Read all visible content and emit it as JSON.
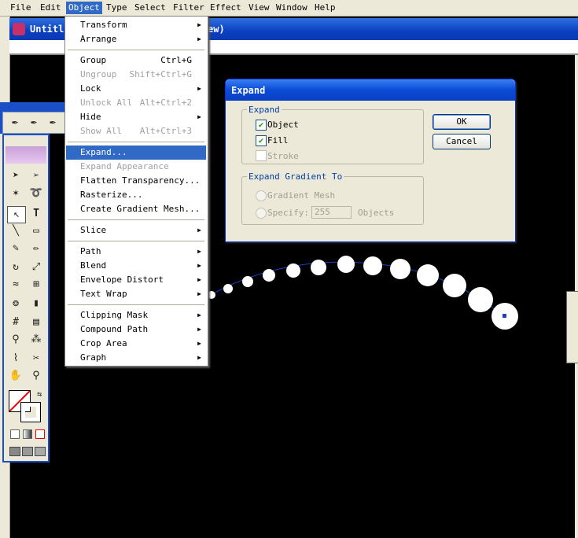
{
  "menubar": {
    "items": [
      {
        "label": "File",
        "active": false
      },
      {
        "label": "Edit",
        "active": false
      },
      {
        "label": "Object",
        "active": true
      },
      {
        "label": "Type",
        "active": false
      },
      {
        "label": "Select",
        "active": false
      },
      {
        "label": "Filter",
        "active": false
      },
      {
        "label": "Effect",
        "active": false
      },
      {
        "label": "View",
        "active": false
      },
      {
        "label": "Window",
        "active": false
      },
      {
        "label": "Help",
        "active": false
      }
    ]
  },
  "document": {
    "title_left": "Untitl",
    "title_right": "ew)"
  },
  "object_menu": {
    "items": [
      {
        "label": "Transform",
        "submenu": true
      },
      {
        "label": "Arrange",
        "submenu": true
      },
      {
        "label": "Group",
        "shortcut": "Ctrl+G"
      },
      {
        "label": "Ungroup",
        "shortcut": "Shift+Ctrl+G",
        "disabled": true
      },
      {
        "label": "Lock",
        "submenu": true
      },
      {
        "label": "Unlock All",
        "shortcut": "Alt+Ctrl+2",
        "disabled": true
      },
      {
        "label": "Hide",
        "submenu": true
      },
      {
        "label": "Show All",
        "shortcut": "Alt+Ctrl+3",
        "disabled": true
      },
      {
        "label": "Expand...",
        "highlighted": true
      },
      {
        "label": "Expand Appearance",
        "disabled": true
      },
      {
        "label": "Flatten Transparency..."
      },
      {
        "label": "Rasterize..."
      },
      {
        "label": "Create Gradient Mesh..."
      },
      {
        "label": "Slice",
        "submenu": true
      },
      {
        "label": "Path",
        "submenu": true
      },
      {
        "label": "Blend",
        "submenu": true
      },
      {
        "label": "Envelope Distort",
        "submenu": true
      },
      {
        "label": "Text Wrap",
        "submenu": true
      },
      {
        "label": "Clipping Mask",
        "submenu": true
      },
      {
        "label": "Compound Path",
        "submenu": true
      },
      {
        "label": "Crop Area",
        "submenu": true
      },
      {
        "label": "Graph",
        "submenu": true
      }
    ]
  },
  "expand_dialog": {
    "title": "Expand",
    "expand_group": {
      "legend": "Expand",
      "object": {
        "label": "Object",
        "checked": true
      },
      "fill": {
        "label": "Fill",
        "checked": true
      },
      "stroke": {
        "label": "Stroke",
        "checked": false,
        "disabled": true
      }
    },
    "gradient_group": {
      "legend": "Expand Gradient To",
      "gradient_mesh": {
        "label": "Gradient Mesh",
        "disabled": true
      },
      "specify": {
        "label": "Specify:",
        "value": "255",
        "unit": "Objects",
        "disabled": true
      }
    },
    "ok_label": "OK",
    "cancel_label": "Cancel"
  },
  "colors": {
    "menu_highlight": "#316ac5",
    "title_blue": "#0a4bd6",
    "canvas": "#000000",
    "path_stroke": "#1e3fbf"
  }
}
